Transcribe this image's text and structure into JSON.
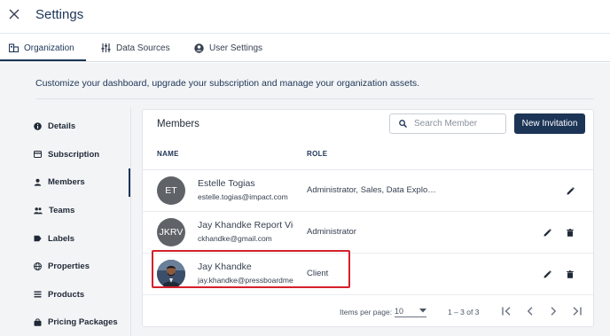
{
  "header": {
    "title": "Settings",
    "close_icon": "close-icon"
  },
  "tabs": [
    {
      "label": "Organization",
      "icon": "building-icon",
      "active": true
    },
    {
      "label": "Data Sources",
      "icon": "sliders-icon",
      "active": false
    },
    {
      "label": "User Settings",
      "icon": "account-circle-icon",
      "active": false
    }
  ],
  "intro": "Customize your dashboard, upgrade your subscription and manage your organization assets.",
  "sidebar": {
    "items": [
      {
        "label": "Details",
        "icon": "info-icon"
      },
      {
        "label": "Subscription",
        "icon": "credit-card-icon"
      },
      {
        "label": "Members",
        "icon": "person-icon",
        "active": true
      },
      {
        "label": "Teams",
        "icon": "people-icon"
      },
      {
        "label": "Labels",
        "icon": "label-icon"
      },
      {
        "label": "Properties",
        "icon": "globe-icon"
      },
      {
        "label": "Products",
        "icon": "list-icon"
      },
      {
        "label": "Pricing Packages",
        "icon": "bag-icon"
      }
    ]
  },
  "members": {
    "title": "Members",
    "search_placeholder": "Search Member",
    "new_button": "New Invitation",
    "columns": {
      "name": "NAME",
      "role": "ROLE"
    },
    "rows": [
      {
        "initials": "ET",
        "name": "Estelle Togias",
        "email": "estelle.togias@impact.com",
        "role": "Administrator, Sales, Data Explo…",
        "deletable": false
      },
      {
        "initials": "JKRV",
        "name": "Jay Khandke Report Vie",
        "email": "ckhandke@gmail.com",
        "role": "Administrator",
        "deletable": true
      },
      {
        "initials": "",
        "name": "Jay Khandke",
        "email": "jay.khandke@pressboardmedia",
        "role": "Client",
        "deletable": true,
        "has_photo": true,
        "highlighted": true
      }
    ],
    "paginator": {
      "label": "Items per page:",
      "page_size": "10",
      "range": "1 – 3 of 3"
    }
  },
  "colors": {
    "primary": "#1c3557",
    "highlight": "#d4202a",
    "avatar": "#5f6368"
  }
}
